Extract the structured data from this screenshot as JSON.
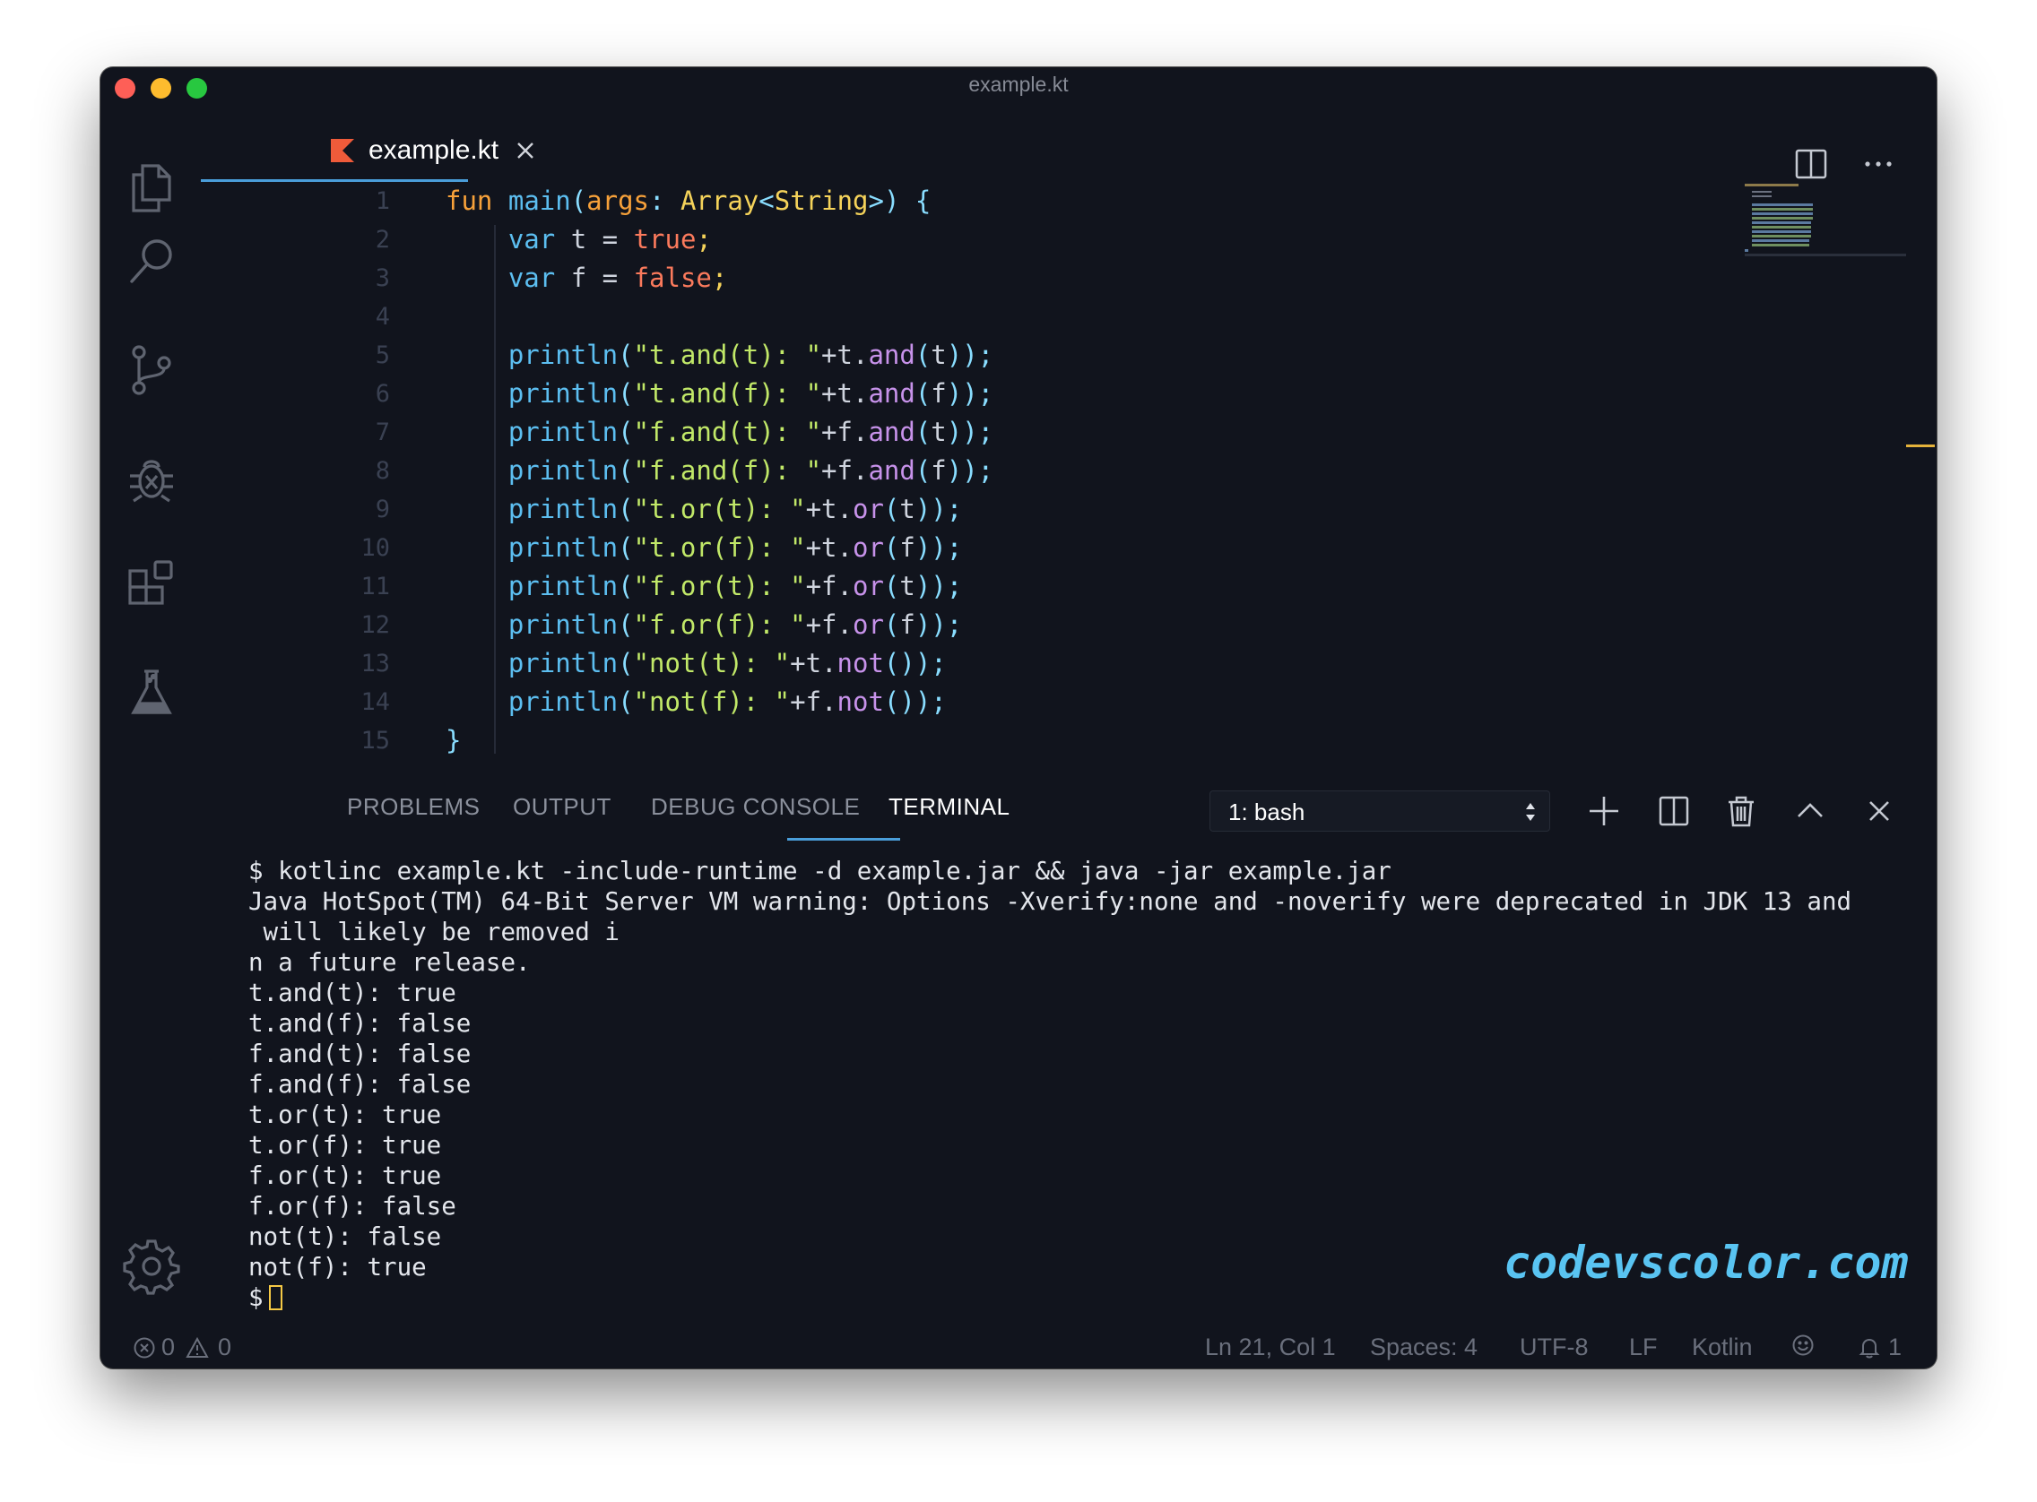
{
  "window": {
    "title": "example.kt"
  },
  "activity_bar": {
    "icons": [
      "files-icon",
      "search-icon",
      "source-control-icon",
      "debug-icon",
      "extensions-icon",
      "flask-icon",
      "gear-icon"
    ]
  },
  "tab": {
    "label": "example.kt",
    "icon": "kotlin-icon"
  },
  "editor": {
    "line_numbers": [
      "1",
      "2",
      "3",
      "4",
      "5",
      "6",
      "7",
      "8",
      "9",
      "10",
      "11",
      "12",
      "13",
      "14",
      "15"
    ]
  },
  "panel": {
    "tabs": [
      "PROBLEMS",
      "OUTPUT",
      "DEBUG CONSOLE",
      "TERMINAL"
    ],
    "active_tab": "TERMINAL",
    "terminal_select": "1: bash"
  },
  "terminal": {
    "lines": [
      "$ kotlinc example.kt -include-runtime -d example.jar && java -jar example.jar",
      "Java HotSpot(TM) 64-Bit Server VM warning: Options -Xverify:none and -noverify were deprecated in JDK 13 and",
      " will likely be removed i",
      "n a future release.",
      "t.and(t): true",
      "t.and(f): false",
      "f.and(t): false",
      "f.and(f): false",
      "t.or(t): true",
      "t.or(f): true",
      "f.or(t): true",
      "f.or(f): false",
      "not(t): false",
      "not(f): true",
      "$"
    ]
  },
  "watermark": "codevscolor.com",
  "status_bar": {
    "errors": "0",
    "warnings": "0",
    "position": "Ln 21, Col 1",
    "spaces": "Spaces: 4",
    "encoding": "UTF-8",
    "eol": "LF",
    "language": "Kotlin",
    "notifications": "1"
  },
  "colors": {
    "background": "#11141d",
    "accent": "#4a9eda",
    "keyword": "#f7a13a",
    "function": "#5cbef0",
    "string": "#c1e868",
    "type": "#f5d35a",
    "boolean": "#fb7a5c",
    "method": "#c792ea"
  }
}
